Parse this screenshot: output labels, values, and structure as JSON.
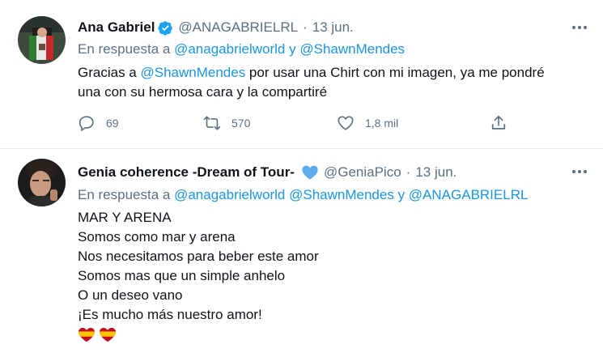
{
  "tweets": [
    {
      "author_name": "Ana Gabriel",
      "handle": "@ANAGABRIELRL",
      "separator": "·",
      "date": "13 jun.",
      "reply_prefix": "En respuesta a",
      "reply_mention_1": "@anagabrielworld",
      "reply_connector": "y",
      "reply_mention_2": "@ShawnMendes",
      "text_part1": "Gracias a ",
      "text_mention": "@ShawnMendes",
      "text_part2": " por usar una Chirt con mi imagen, ya me pondré",
      "text_line2": "una con su hermosa cara y la compartiré",
      "stats": {
        "replies": "69",
        "retweets": "570",
        "likes": "1,8 mil"
      }
    },
    {
      "author_name": "Genia coherence -Dream of Tour-",
      "handle": "@GeniaPico",
      "separator": "·",
      "date": "13 jun.",
      "reply_prefix": "En respuesta a",
      "reply_mention_1": "@anagabrielworld",
      "reply_mention_2": "@ShawnMendes",
      "reply_connector": "y",
      "reply_mention_3": "@ANAGABRIELRL",
      "lines": [
        "MAR Y ARENA",
        "Somos como mar y arena",
        "Nos necesitamos para beber este amor",
        "Somos mas que un simple anhelo",
        "O un deseo vano",
        "¡Es mucho más nuestro amor!"
      ]
    }
  ],
  "icons": {
    "verified": "verified-badge-icon",
    "more": "more-options-icon",
    "reply": "reply-icon",
    "retweet": "retweet-icon",
    "like": "like-icon",
    "share": "share-icon",
    "blue_heart": "blue-heart-emoji",
    "flag_hearts": "spain-flag-heart-emoji"
  },
  "colors": {
    "link": "#1b95e0",
    "muted": "#5b7083",
    "text": "#0f1419",
    "verified": "#1da1f2",
    "divider": "#e6ecf0"
  }
}
